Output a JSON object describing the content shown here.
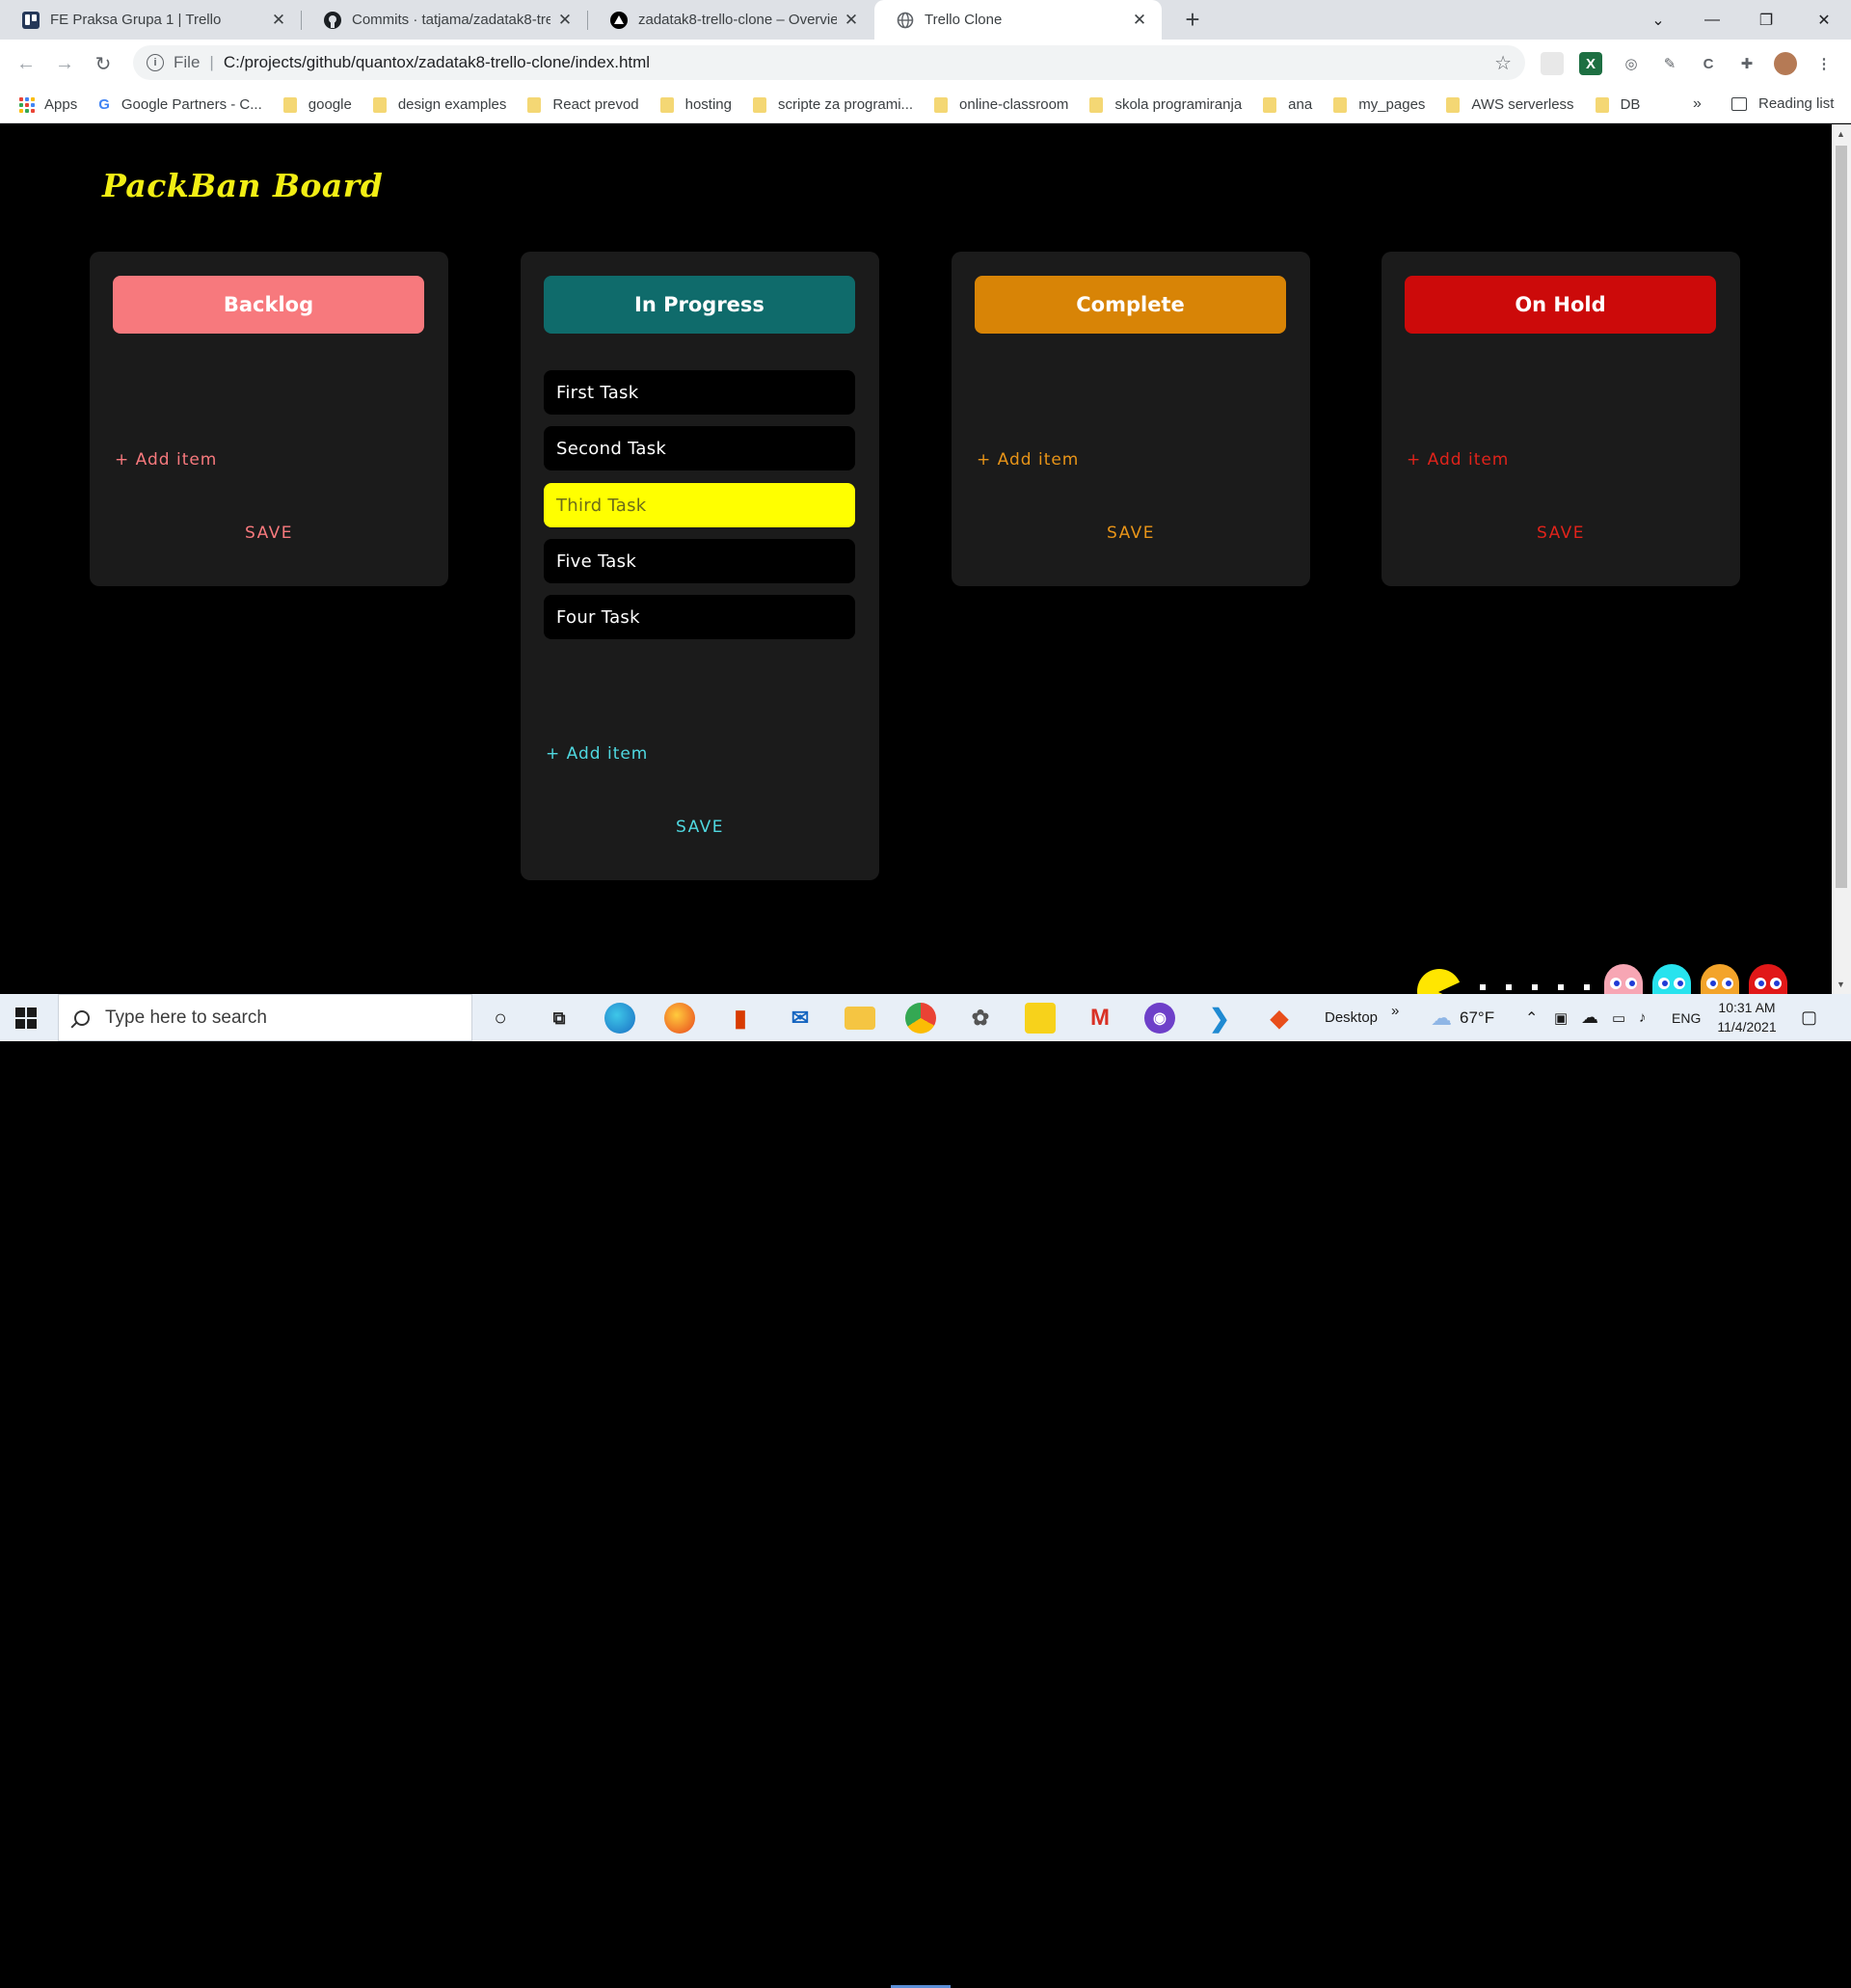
{
  "browser": {
    "tabs": [
      {
        "title": "FE Praksa Grupa 1 | Trello",
        "icon": "trello-icon",
        "active": false
      },
      {
        "title": "Commits · tatjama/zadatak8-trello-clone",
        "icon": "github-icon",
        "active": false
      },
      {
        "title": "zadatak8-trello-clone – Overview",
        "icon": "vercel-icon",
        "active": false
      },
      {
        "title": "Trello Clone",
        "icon": "globe-icon",
        "active": true
      }
    ],
    "new_tab_label": "+",
    "address": {
      "scheme": "File",
      "url": "C:/projects/github/quantox/zadatak8-trello-clone/index.html"
    },
    "bookmarks": [
      "Apps",
      "Google Partners - C...",
      "google",
      "design examples",
      "React prevod",
      "hosting",
      "scripte za programi...",
      "online-classroom",
      "skola programiranja",
      "ana",
      "my_pages",
      "AWS serverless",
      "DB"
    ],
    "bookmarks_more": "»",
    "reading_list": "Reading list"
  },
  "page": {
    "title": "PackBan Board",
    "columns": [
      {
        "name": "Backlog",
        "header_color": "#f7797d",
        "accent_color": "#f7797d",
        "tasks": [],
        "add_label": "+ Add item",
        "save_label": "SAVE"
      },
      {
        "name": "In Progress",
        "header_color": "#0f6b6b",
        "accent_color": "#4fd8e0",
        "tasks": [
          {
            "text": "First Task",
            "highlighted": false
          },
          {
            "text": "Second Task",
            "highlighted": false
          },
          {
            "text": "Third Task",
            "highlighted": true
          },
          {
            "text": "Five Task",
            "highlighted": false
          },
          {
            "text": "Four Task",
            "highlighted": false
          }
        ],
        "add_label": "+ Add item",
        "save_label": "SAVE"
      },
      {
        "name": "Complete",
        "header_color": "#d88406",
        "accent_color": "#e89418",
        "tasks": [],
        "add_label": "+ Add item",
        "save_label": "SAVE"
      },
      {
        "name": "On Hold",
        "header_color": "#cc0a0a",
        "accent_color": "#e0231b",
        "tasks": [],
        "add_label": "+ Add item",
        "save_label": "SAVE"
      }
    ],
    "highlight_color": "#ffff00",
    "title_color": "#f2ee14"
  },
  "taskbar": {
    "search_placeholder": "Type here to search",
    "desktop_label": "Desktop",
    "desktop_chevron": "»",
    "weather": "67°F",
    "language": "ENG",
    "time": "10:31 AM",
    "date": "11/4/2021"
  }
}
